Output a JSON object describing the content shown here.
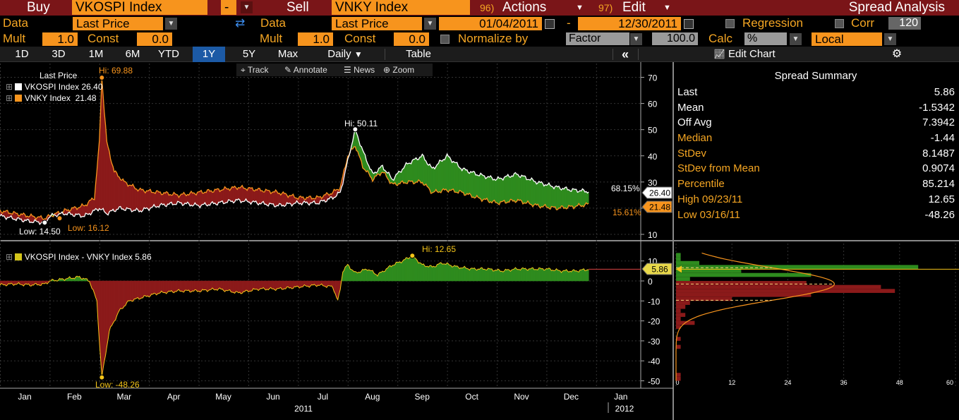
{
  "header": {
    "buy_label": "Buy",
    "buy_ticker": "VKOSPI Index",
    "minus_label": "-",
    "sell_label": "Sell",
    "sell_ticker": "VNKY Index",
    "actions_num": "96)",
    "actions_label": "Actions",
    "edit_num": "97)",
    "edit_label": "Edit",
    "title": "Spread Analysis"
  },
  "row2": {
    "data_label": "Data",
    "data_value": "Last Price",
    "data2_label": "Data",
    "data2_value": "Last Price",
    "start_date": "01/04/2011",
    "dash": "-",
    "end_date": "12/30/2011",
    "regression_label": "Regression",
    "corr_label": "Corr",
    "corr_value": "120"
  },
  "row3": {
    "mult_label": "Mult",
    "mult_value": "1.0",
    "const_label": "Const",
    "const_value": "0.0",
    "mult2_label": "Mult",
    "mult2_value": "1.0",
    "const2_label": "Const",
    "const2_value": "0.0",
    "normalize_label": "Normalize by",
    "normalize_value": "Factor",
    "factor_value": "100.0",
    "calc_label": "Calc",
    "calc_value": "%",
    "currency_value": "Local"
  },
  "tabs": {
    "periods": [
      "1D",
      "3D",
      "1M",
      "6M",
      "YTD",
      "1Y",
      "5Y",
      "Max"
    ],
    "active_period": "1Y",
    "frequency": "Daily",
    "table_label": "Table",
    "collapse_label": "«",
    "edit_chart_label": "Edit Chart"
  },
  "toolbar": {
    "track": "Track",
    "annotate": "Annotate",
    "news": "News",
    "zoom": "Zoom"
  },
  "legend": {
    "title": "Last Price",
    "series1_label": "VKOSPI Index",
    "series1_value": "26.40",
    "series2_label": "VNKY Index",
    "series2_value": "21.48",
    "spread_label": "VKOSPI Index - VNKY Index",
    "spread_value": "5.86"
  },
  "annotations": {
    "hi_vnky": "Hi: 69.88",
    "hi_vkospi": "Hi: 50.11",
    "low_vkospi": "Low: 14.50",
    "low_vnky": "Low: 16.12",
    "pct_top": "68.15%",
    "pct_bottom": "15.61%",
    "last_vkospi": "26.40",
    "last_vnky": "21.48",
    "spread_hi": "Hi: 12.65",
    "spread_low": "Low: -48.26",
    "spread_last": "5.86"
  },
  "summary": {
    "title": "Spread Summary",
    "rows": [
      {
        "key": "Last",
        "value": "5.86",
        "color": "#ffffff"
      },
      {
        "key": "Mean",
        "value": "-1.5342",
        "color": "#ffffff"
      },
      {
        "key": "Off Avg",
        "value": "7.3942",
        "color": "#ffffff"
      },
      {
        "key": "Median",
        "value": "-1.44",
        "color": "#f5a623"
      },
      {
        "key": "StDev",
        "value": "8.1487",
        "color": "#f5a623"
      },
      {
        "key": "StDev from Mean",
        "value": "0.9074",
        "color": "#f5a623"
      },
      {
        "key": "Percentile",
        "value": "85.214",
        "color": "#f5a623"
      },
      {
        "key": "High 09/23/11",
        "value": "12.65",
        "color": "#f5a623"
      },
      {
        "key": "Low 03/16/11",
        "value": "-48.26",
        "color": "#f5a623"
      }
    ]
  },
  "colors": {
    "accent": "#f7941d",
    "header_bg": "#7a1518",
    "vkospi": "#ffffff",
    "vnky": "#f7941d",
    "positive_fill": "#2e8b1e",
    "negative_fill": "#8b1a1a",
    "spread_line": "#f5c518"
  },
  "chart_data": [
    {
      "type": "line",
      "title": "",
      "x_ticks": [
        "Jan",
        "Feb",
        "Mar",
        "Apr",
        "May",
        "Jun",
        "Jul",
        "Aug",
        "Sep",
        "Oct",
        "Nov",
        "Dec",
        "Jan"
      ],
      "x_years": [
        "2011",
        "2012"
      ],
      "ylim": [
        7,
        75
      ],
      "y_ticks": [
        10,
        20,
        30,
        40,
        50,
        60,
        70
      ],
      "series": [
        {
          "name": "VKOSPI Index",
          "x": [
            0,
            0.3,
            0.6,
            0.9,
            1.0,
            1.3,
            1.7,
            2.0,
            2.15,
            2.4,
            2.8,
            3.2,
            3.6,
            4.0,
            4.4,
            4.8,
            5.2,
            5.6,
            6.0,
            6.4,
            6.7,
            6.85,
            7.0,
            7.15,
            7.3,
            7.5,
            7.7,
            7.9,
            8.2,
            8.5,
            8.7,
            9.0,
            9.3,
            9.6,
            10.0,
            10.4,
            10.8,
            11.2,
            11.5,
            11.85
          ],
          "values": [
            17,
            16,
            15,
            14.5,
            17,
            18,
            17,
            20,
            18,
            20,
            19,
            21,
            22,
            21,
            22,
            23,
            22,
            21,
            22,
            22,
            24,
            26,
            38,
            50.11,
            42,
            33,
            36,
            31,
            37,
            40,
            35,
            40,
            35,
            33,
            31,
            33,
            30,
            28,
            27,
            26.4
          ]
        },
        {
          "name": "VNKY Index",
          "x": [
            0,
            0.3,
            0.6,
            0.9,
            1.0,
            1.3,
            1.7,
            1.9,
            2.0,
            2.05,
            2.15,
            2.3,
            2.5,
            2.8,
            3.2,
            3.6,
            4.0,
            4.4,
            4.8,
            5.2,
            5.6,
            6.0,
            6.4,
            6.7,
            6.85,
            7.0,
            7.15,
            7.3,
            7.5,
            7.7,
            7.9,
            8.2,
            8.5,
            8.7,
            9.0,
            9.3,
            9.6,
            10.0,
            10.4,
            10.8,
            11.2,
            11.5,
            11.85
          ],
          "values": [
            19,
            18,
            17,
            16.12,
            17,
            19,
            21,
            24,
            45,
            69.88,
            45,
            34,
            30,
            27,
            26,
            25,
            26,
            27,
            28,
            27,
            26,
            24,
            24,
            26,
            28,
            40,
            44,
            36,
            31,
            34,
            29,
            30,
            30,
            26,
            27,
            26,
            24,
            22,
            23,
            21,
            20,
            20.5,
            21.48
          ]
        }
      ],
      "annotations": [
        "Hi: 69.88",
        "Hi: 50.11",
        "Low: 14.50",
        "Low: 16.12",
        "68.15%",
        "15.61%"
      ]
    },
    {
      "type": "area",
      "title": "",
      "ylim": [
        -52,
        15
      ],
      "y_ticks": [
        -50,
        -40,
        -30,
        -20,
        -10,
        0,
        10
      ],
      "series": [
        {
          "name": "VKOSPI Index - VNKY Index",
          "x": [
            0,
            0.3,
            0.6,
            0.9,
            1.0,
            1.3,
            1.6,
            1.8,
            1.95,
            2.0,
            2.05,
            2.2,
            2.4,
            2.6,
            2.9,
            3.2,
            3.6,
            4.0,
            4.4,
            4.8,
            5.2,
            5.6,
            6.0,
            6.4,
            6.7,
            6.8,
            6.85,
            6.9,
            7.0,
            7.15,
            7.4,
            7.6,
            7.9,
            8.1,
            8.3,
            8.5,
            8.7,
            8.9,
            9.2,
            9.5,
            9.8,
            10.1,
            10.4,
            10.7,
            11.0,
            11.3,
            11.6,
            11.85
          ],
          "values": [
            -2,
            -1.5,
            -2,
            -1.6,
            0,
            1,
            2,
            0,
            -10,
            -30,
            -48.26,
            -25,
            -15,
            -10,
            -8,
            -6,
            -5,
            -5,
            -4,
            -6,
            -4,
            -4,
            -3,
            -2,
            -3,
            -10,
            -4,
            5,
            8,
            4,
            6,
            3,
            8,
            10,
            12.65,
            8,
            7,
            9,
            7,
            6,
            6,
            5,
            6,
            6,
            6,
            5,
            5,
            5.86
          ]
        }
      ],
      "annotations": [
        "Hi: 12.65",
        "Low: -48.26",
        "5.86"
      ]
    },
    {
      "type": "bar",
      "title": "",
      "orientation": "horizontal",
      "xlim": [
        0,
        60
      ],
      "x_ticks": [
        0,
        12,
        24,
        36,
        48,
        60
      ],
      "ylim": [
        -52,
        15
      ],
      "bins": [
        13,
        11,
        9,
        7,
        5,
        3,
        1,
        -1,
        -3,
        -5,
        -7,
        -9,
        -11,
        -13,
        -15,
        -17,
        -19,
        -21,
        -23,
        -29,
        -33,
        -47,
        -49
      ],
      "values": [
        1,
        1,
        5,
        52,
        14,
        29,
        3,
        28,
        44,
        47,
        29,
        12,
        3,
        2,
        1,
        2,
        1,
        4,
        1,
        1,
        1,
        1,
        1
      ],
      "normal_fit": {
        "mean": -1.5342,
        "stdev": 8.1487
      }
    }
  ]
}
